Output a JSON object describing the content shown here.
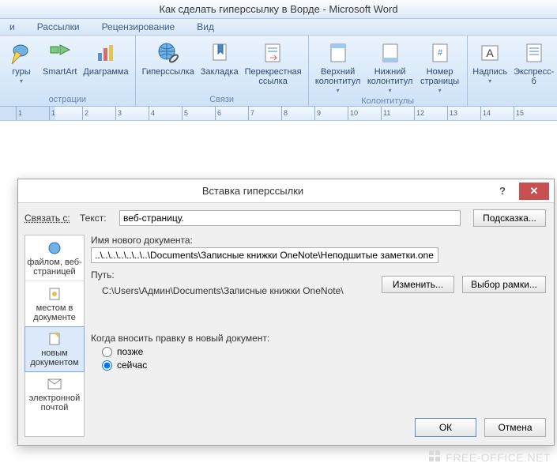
{
  "window": {
    "title": "Как сделать гиперссылку в Ворде - Microsoft Word"
  },
  "tabs": [
    "и",
    "Рассылки",
    "Рецензирование",
    "Вид"
  ],
  "ribbon": {
    "groups": [
      {
        "label": "острации",
        "items": [
          {
            "name": "shapes",
            "label": "гуры"
          },
          {
            "name": "smartart",
            "label": "SmartArt"
          },
          {
            "name": "chart",
            "label": "Диаграмма"
          }
        ]
      },
      {
        "label": "Связи",
        "items": [
          {
            "name": "hyperlink",
            "label": "Гиперссылка"
          },
          {
            "name": "bookmark",
            "label": "Закладка"
          },
          {
            "name": "crossref",
            "label": "Перекрестная\nссылка"
          }
        ]
      },
      {
        "label": "Колонтитулы",
        "items": [
          {
            "name": "header",
            "label": "Верхний\nколонтитул"
          },
          {
            "name": "footer",
            "label": "Нижний\nколонтитул"
          },
          {
            "name": "pagenum",
            "label": "Номер\nстраницы"
          }
        ]
      },
      {
        "label": "",
        "items": [
          {
            "name": "textbox",
            "label": "Надпись"
          },
          {
            "name": "quickparts",
            "label": "Экспресс-б"
          }
        ]
      }
    ]
  },
  "ruler": {
    "numbers": [
      "1",
      "1",
      "2",
      "3",
      "4",
      "5",
      "6",
      "7",
      "8",
      "9",
      "10",
      "11",
      "12",
      "13",
      "14",
      "15"
    ]
  },
  "dialog": {
    "title": "Вставка гиперссылки",
    "link_with": "Связать с:",
    "text_label": "Текст:",
    "text_value": "веб-страницу.",
    "screen_tip": "Подсказка...",
    "newdoc_label": "Имя нового документа:",
    "newdoc_value": "..\\..\\..\\..\\..\\..\\..\\Documents\\Записные книжки OneNote\\Неподшитые заметки.one",
    "path_label": "Путь:",
    "path_value": "C:\\Users\\Админ\\Documents\\Записные книжки OneNote\\",
    "change": "Изменить...",
    "target_frame": "Выбор рамки...",
    "when_label": "Когда вносить правку в новый документ:",
    "later": "позже",
    "now": "сейчас",
    "ok": "ОК",
    "cancel": "Отмена",
    "side": {
      "existing": "файлом, веб-\nстраницей",
      "place": "местом в\nдокументе",
      "newdoc": "новым\nдокументом",
      "email": "электронной\nпочтой"
    }
  },
  "watermark": "FREE-OFFICE.NET"
}
